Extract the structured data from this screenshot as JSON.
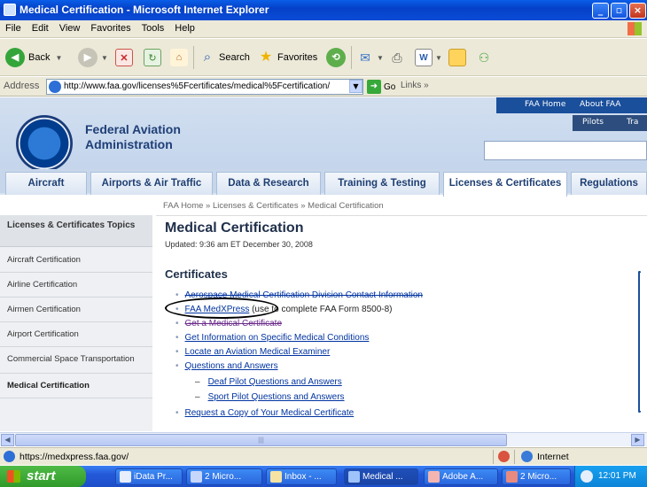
{
  "window": {
    "title": "Medical Certification - Microsoft Internet Explorer",
    "minimize_label": "_",
    "maximize_label": "▫",
    "close_label": "×"
  },
  "menu": [
    "File",
    "Edit",
    "View",
    "Favorites",
    "Tools",
    "Help"
  ],
  "toolbar": {
    "back_label": "Back",
    "search_label": "Search",
    "favorites_label": "Favorites"
  },
  "address": {
    "label": "Address",
    "url": "http://www.faa.gov/licenses%5Fcertificates/medical%5Fcertification/",
    "go_label": "Go",
    "links_label": "Links"
  },
  "site": {
    "agency_line1": "Federal Aviation",
    "agency_line2": "Administration",
    "topnav": [
      "FAA Home",
      "About FAA"
    ],
    "topnav2": [
      "Pilots",
      "Tra"
    ],
    "tabs": [
      "Aircraft",
      "Airports & Air Traffic",
      "Data & Research",
      "Training & Testing",
      "Licenses & Certificates",
      "Regulations"
    ]
  },
  "breadcrumb": "FAA Home  »  Licenses & Certificates  »  Medical Certification",
  "sidebar": {
    "heading": "Licenses & Certificates Topics",
    "items": [
      "Aircraft Certification",
      "Airline Certification",
      "Airmen Certification",
      "Airport Certification",
      "Commercial Space Transportation",
      "Medical Certification"
    ]
  },
  "content": {
    "title": "Medical Certification",
    "updated": "Updated: 9:36 am ET December 30, 2008",
    "section": "Certificates",
    "links": [
      "Aerospace Medical Certification Division Contact Information",
      "FAA MedXPress",
      "Get a Medical Certificate",
      "Get Information on Specific Medical Conditions",
      "Locate an Aviation Medical Examiner",
      "Questions and Answers",
      "Deaf Pilot Questions and Answers",
      "Sport Pilot Questions and Answers",
      "Request a Copy of Your Medical Certificate"
    ],
    "medxpress_suffix": " (use to complete FAA Form 8500-8)"
  },
  "status": {
    "text": "https://medxpress.faa.gov/",
    "zone": "Internet"
  },
  "taskbar": {
    "start_label": "start",
    "tasks": [
      "iData Pr...",
      "2 Micro...",
      "Inbox - ...",
      "Medical ...",
      "Adobe A...",
      "2 Micro..."
    ],
    "clock": "12:01 PM"
  },
  "colors": {
    "link": "#0033a0",
    "titlebar": "#0a5ee8",
    "header_bg": "#c4d5ec"
  }
}
